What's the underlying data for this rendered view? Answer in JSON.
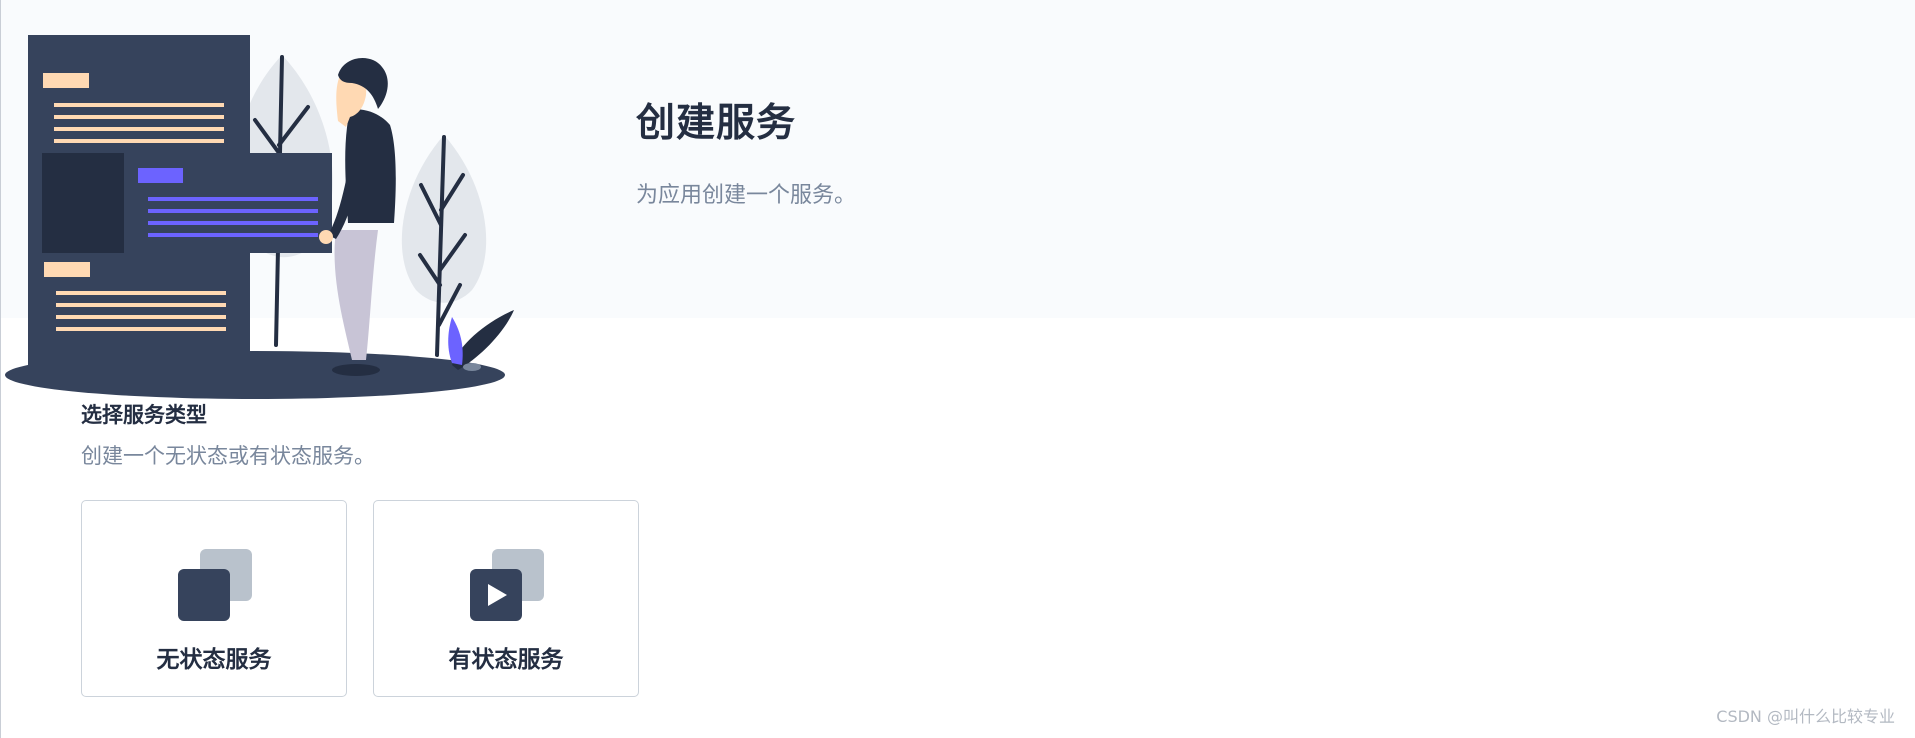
{
  "header": {
    "title": "创建服务",
    "description": "为应用创建一个服务。"
  },
  "section": {
    "title": "选择服务类型",
    "description": "创建一个无状态或有状态服务。"
  },
  "service_types": [
    {
      "label": "无状态服务",
      "icon": "stateless-service-icon"
    },
    {
      "label": "有状态服务",
      "icon": "stateful-service-icon"
    }
  ],
  "watermark": "CSDN @叫什么比较专业",
  "colors": {
    "header_background": "#f9fbfd",
    "title": "#242e42",
    "secondary_text": "#79879c",
    "icon_dark": "#36435c",
    "icon_light": "#b9c2cc",
    "card_border": "#ccd3db",
    "illustration_accent": "#6c63ff",
    "illustration_highlight": "#ffd9b3"
  }
}
